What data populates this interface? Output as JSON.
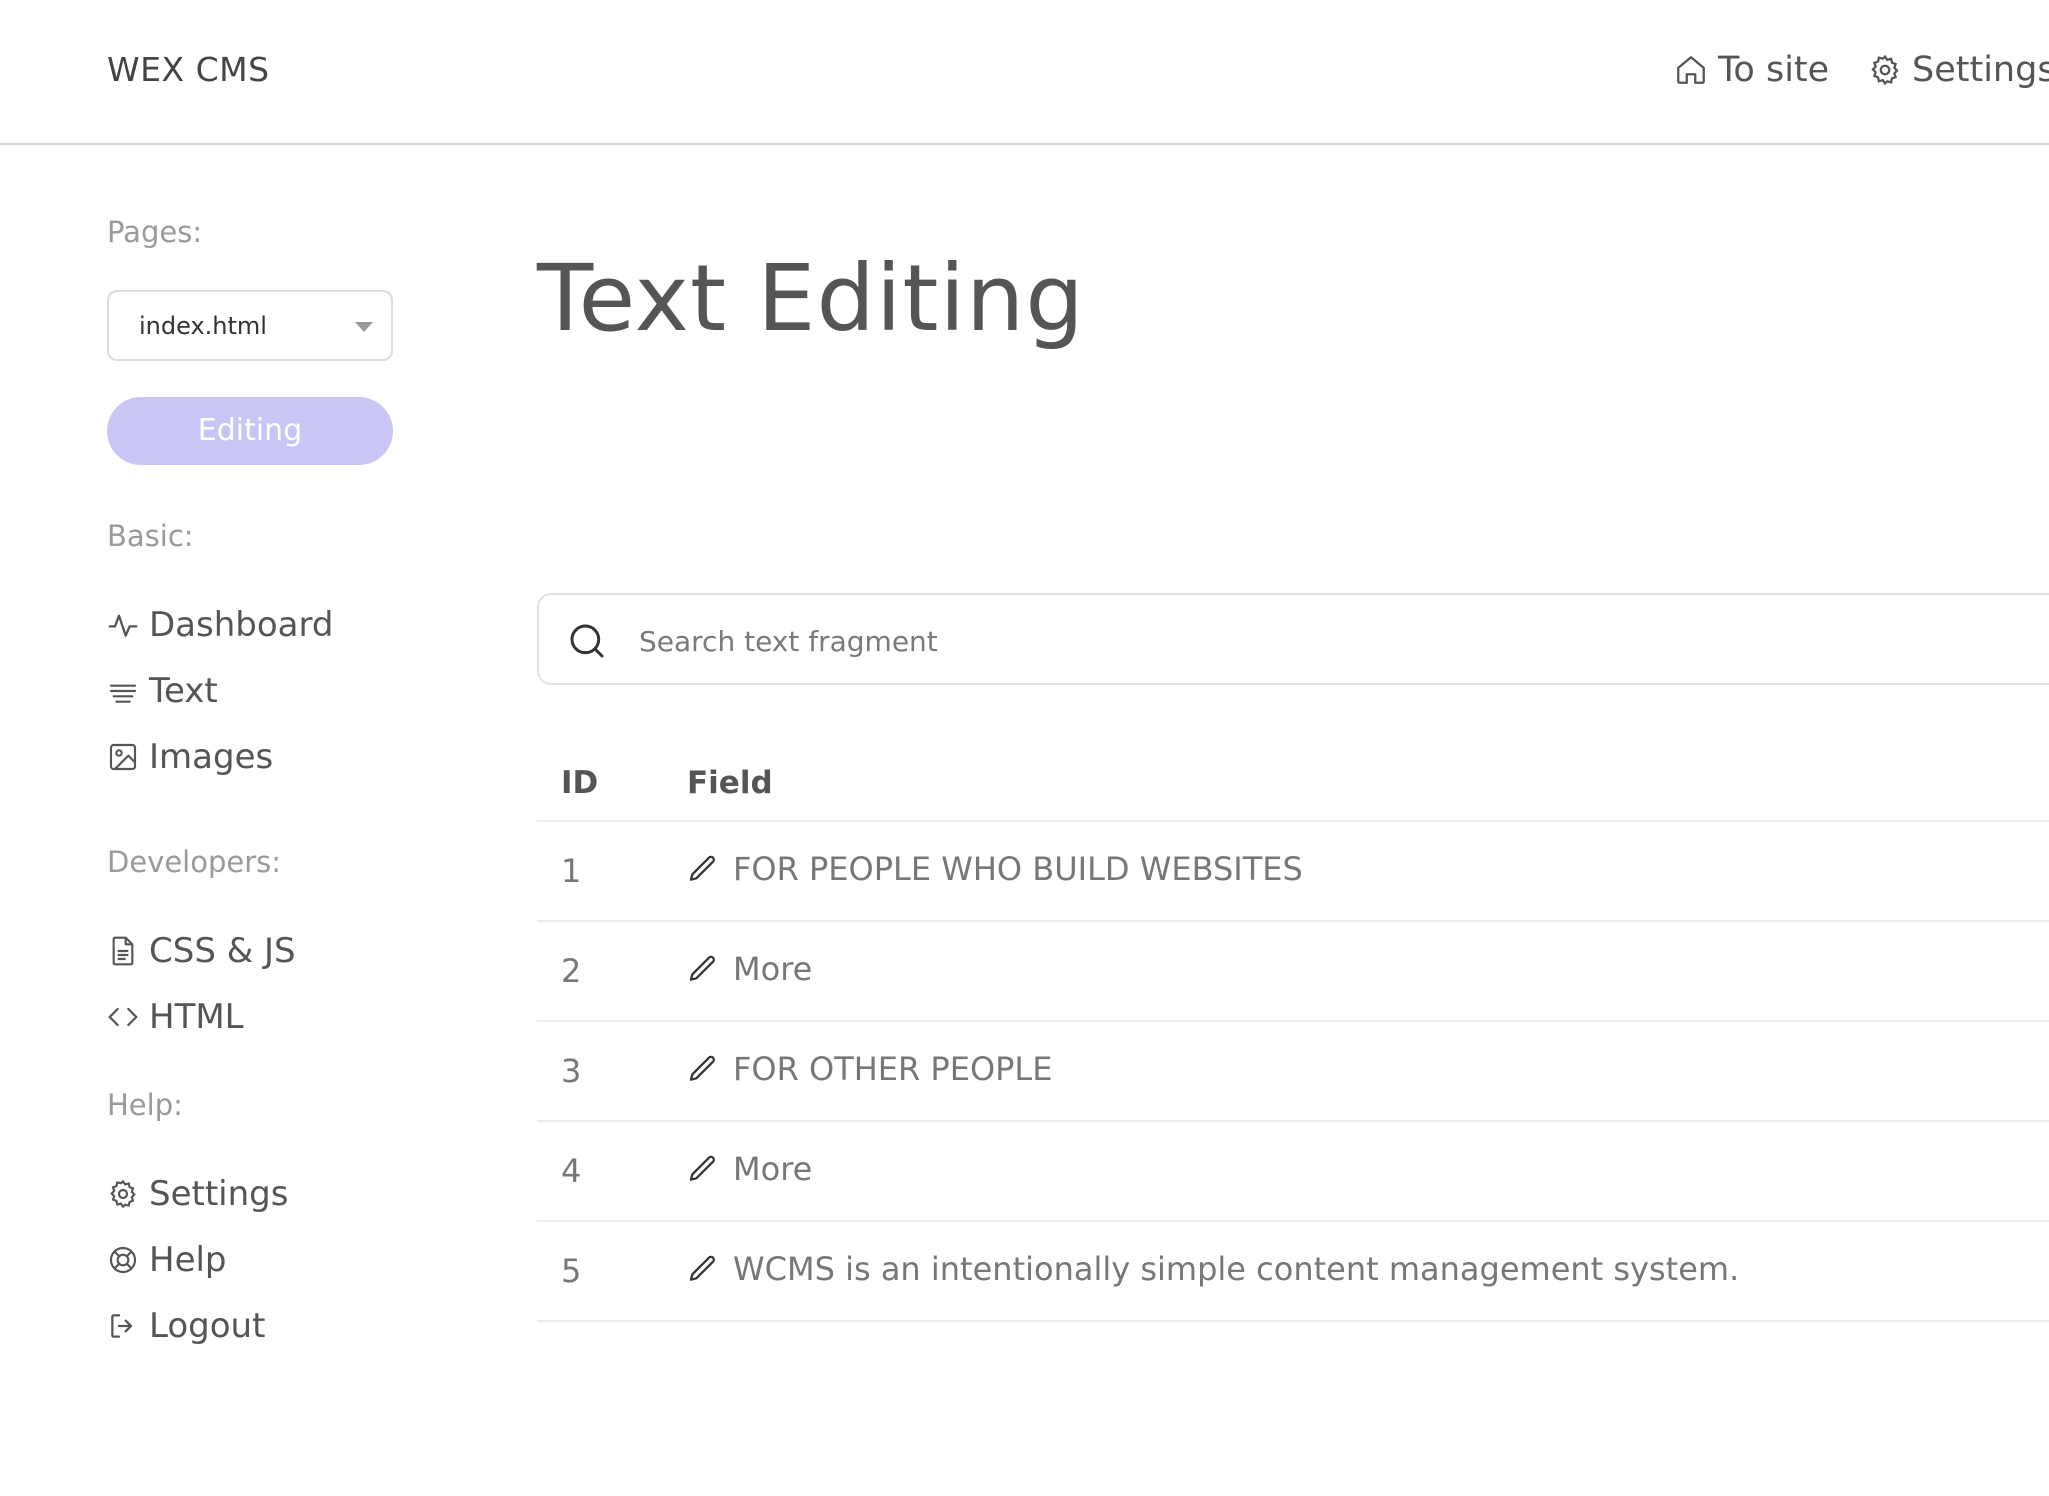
{
  "header": {
    "brand": "WEX CMS",
    "to_site_label": "To site",
    "settings_label": "Settings"
  },
  "sidebar": {
    "pages_label": "Pages:",
    "page_select_value": "index.html",
    "editing_button": "Editing",
    "basic_label": "Basic:",
    "basic_items": [
      {
        "label": "Dashboard",
        "icon": "activity-icon"
      },
      {
        "label": "Text",
        "icon": "text-lines-icon"
      },
      {
        "label": "Images",
        "icon": "image-icon"
      }
    ],
    "developers_label": "Developers:",
    "developer_items": [
      {
        "label": "CSS & JS",
        "icon": "file-icon"
      },
      {
        "label": "HTML",
        "icon": "code-icon"
      }
    ],
    "help_label": "Help:",
    "help_items": [
      {
        "label": "Settings",
        "icon": "gear-icon"
      },
      {
        "label": "Help",
        "icon": "lifebuoy-icon"
      },
      {
        "label": "Logout",
        "icon": "logout-icon"
      }
    ]
  },
  "main": {
    "title": "Text Editing",
    "search_placeholder": "Search text fragment",
    "table": {
      "columns": [
        "ID",
        "Field"
      ],
      "rows": [
        {
          "id": "1",
          "field": "FOR PEOPLE WHO BUILD WEBSITES"
        },
        {
          "id": "2",
          "field": "More"
        },
        {
          "id": "3",
          "field": "FOR OTHER PEOPLE"
        },
        {
          "id": "4",
          "field": "More"
        },
        {
          "id": "5",
          "field": "WCMS is an intentionally simple content management system."
        }
      ]
    }
  },
  "colors": {
    "accent_button": "#c9c6f5",
    "border": "#d5d5d5",
    "text": "#555555",
    "muted": "#9a9a9a"
  }
}
